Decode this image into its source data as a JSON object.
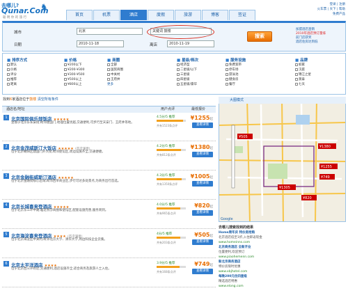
{
  "logo": {
    "top": "去哪儿?",
    "main": "Qunar.Com",
    "sub": "聪 明 你 的 旅 行"
  },
  "nav": [
    {
      "label": "首页"
    },
    {
      "label": "机票"
    },
    {
      "label": "酒店"
    },
    {
      "label": "度假"
    },
    {
      "label": "旅游"
    },
    {
      "label": "博客"
    },
    {
      "label": "签证"
    }
  ],
  "toplinks": [
    "登录 | 注册",
    "火车票 | 天下 | 帮助",
    "免费产品"
  ],
  "search": {
    "city_label": "城市",
    "city_value": "北京",
    "keyword_label": "关键词",
    "keyword_value": "鼓楼",
    "date_label": "日期",
    "checkin_value": "2010-11-18",
    "checkout_label": "离店",
    "checkout_value": "2010-11-19",
    "button": "搜索"
  },
  "promo": {
    "title": "加盟酒店直销",
    "line1": "2010年酒店预订量排",
    "line2": "前门店获奖",
    "line3": "酒店住房达到低"
  },
  "filters": [
    {
      "title": "排序方式",
      "options": [
        "默认",
        "价格",
        "评分",
        "推荐",
        "距离"
      ]
    },
    {
      "title": "价格",
      "options": [
        "¥200以下",
        "¥200-¥300",
        "¥300-¥500",
        "¥500以上",
        "¥800以上"
      ]
    },
    {
      "title": "商圈",
      "options": [
        "全部",
        "国贸商圈",
        "中关村",
        "王府井",
        "更多"
      ]
    },
    {
      "title": "星级/档次",
      "options": [
        "经济型",
        "二星级/以下",
        "三星级",
        "四星级",
        "五星级/豪华"
      ]
    },
    {
      "title": "服务设施",
      "options": [
        "免费宽带",
        "停车场",
        "游泳池",
        "健身房",
        "餐厅"
      ]
    },
    {
      "title": "品牌",
      "options": [
        "如家",
        "汉庭",
        "锦江之星",
        "莫泰",
        "七天"
      ]
    }
  ],
  "crumb": {
    "pre": "找到",
    "count": "6",
    "mid": "家酒店位于",
    "place": "鼓楼",
    "link": "清空所有条件"
  },
  "list": {
    "col1": "酒店名/地址",
    "col2": "用户点评",
    "col3": "最低报价"
  },
  "hotels": [
    {
      "num": "1",
      "name": "北京国际俱乐部饭店",
      "stars": "★★★★★",
      "badge": "",
      "desc": "坐落于北京东长安街,毗邻建国门,地理位置优越,交通便利,可步行至天安门、王府井等地。",
      "rating": "4.5分/5 推荐",
      "fill": 0.9,
      "sub": "共有1523条点评",
      "price": "¥1255",
      "unit": "起",
      "btn": "查看详情"
    },
    {
      "num": "2",
      "name": "北京金茂威斯汀大饭店",
      "stars": "★★★★★",
      "badge": "(首次满意)",
      "desc": "位于北京朝阳区建国门外大街,毗邻使馆区,周边设施齐全,交通便捷。",
      "rating": "4.2分/5 推荐",
      "fill": 0.84,
      "sub": "共有812条点评",
      "price": "¥1380",
      "unit": "起",
      "btn": "查看详情"
    },
    {
      "num": "3",
      "name": "北京金融街威斯汀酒店",
      "stars": "★★★★★",
      "badge": "",
      "desc": "位于北京金融街核心区域,毗邻西单商业区,步行可达多处景点,为商务出行首选。",
      "rating": "4.3分/5 推荐",
      "fill": 0.86,
      "sub": "共有1350条点评",
      "price": "¥1005",
      "unit": "起",
      "btn": "查看详情"
    },
    {
      "num": "4",
      "name": "北京长城喜来登酒店",
      "stars": "★★★★★",
      "badge": "",
      "desc": "位于北京东三环中路,临近燕莎商圈和使馆区,配套设施完善,服务周到。",
      "rating": "4.0分/5 推荐",
      "fill": 0.8,
      "sub": "共有965条点评",
      "price": "¥820",
      "unit": "起",
      "btn": "查看详情"
    },
    {
      "num": "5",
      "name": "北京海淀喜来登酒店",
      "stars": "★★★★",
      "badge": "(首次满意)",
      "desc": "位于北京海淀区中关村,毗邻北京大学、清华大学,周边科技企业云集。",
      "rating": "4分/5 推荐",
      "fill": 0.8,
      "sub": "共有203条点评",
      "price": "¥505",
      "unit": "起",
      "btn": "查看详情"
    },
    {
      "num": "6",
      "name": "北京太平洋酒店",
      "stars": "★★★★",
      "badge": "",
      "desc": "位于北京西三环附近,交通便利,酒店设施齐全,适合商务及旅游人士入住。",
      "rating": "3.9分/5 推荐",
      "fill": 0.78,
      "sub": "共有168条点评",
      "price": "¥749",
      "unit": "起",
      "btn": "查看详情"
    }
  ],
  "map": {
    "header": "大图模式",
    "prices": [
      "¥505",
      "¥1380",
      "¥1305",
      "¥749",
      "¥1255",
      "¥820"
    ]
  },
  "ads": {
    "title": "去哪儿搜索找到的结果",
    "items": [
      {
        "title": "Home周年庆 特价房抢购",
        "desc": "北京酒店低至1折,入住即返现金",
        "url": "www.homeinns.com"
      },
      {
        "title": "北京商务酒店 全新开业",
        "desc": "位置便利,欢迎预订",
        "url": "www.piaohemenn.com"
      },
      {
        "title": "新北京商务酒店",
        "desc": "特价房限时优惠",
        "url": "www.xbjhotel.com"
      },
      {
        "title": "每晚200元住四星级",
        "desc": "精选酒店特惠",
        "url": "www.elong.com"
      }
    ]
  }
}
